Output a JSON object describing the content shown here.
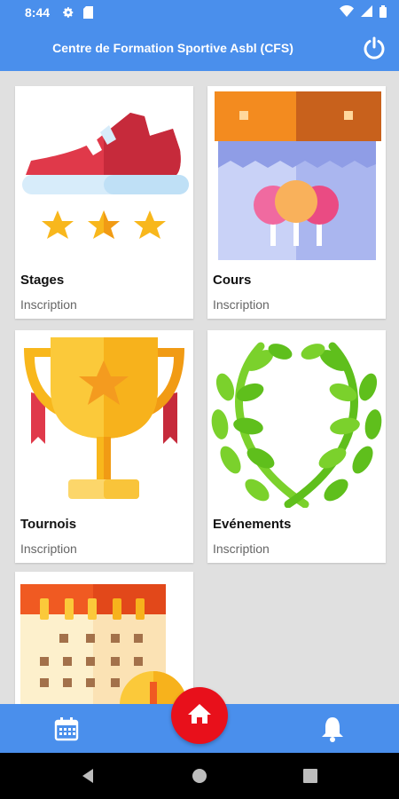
{
  "status_bar": {
    "time": "8:44",
    "icons": [
      "settings-icon",
      "sim-card-icon",
      "wifi-icon",
      "signal-icon",
      "battery-icon"
    ]
  },
  "app_bar": {
    "title": "Centre de Formation Sportive Asbl (CFS)",
    "power_icon": "power-icon"
  },
  "cards": [
    {
      "name": "Stages",
      "subtitle": "Inscription",
      "icon": "sneaker-icon"
    },
    {
      "name": "Cours",
      "subtitle": "Inscription",
      "icon": "party-balloons-icon"
    },
    {
      "name": "Tournois",
      "subtitle": "Inscription",
      "icon": "trophy-icon"
    },
    {
      "name": "Evénements",
      "subtitle": "Inscription",
      "icon": "laurel-wreath-icon"
    },
    {
      "name": "",
      "subtitle": "",
      "icon": "calendar-icon"
    }
  ],
  "bottom_nav": {
    "items": [
      "calendar-icon",
      "home-icon",
      "bell-icon"
    ],
    "active": "home"
  },
  "system_nav": [
    "back-icon",
    "home-circle-icon",
    "recents-icon"
  ],
  "colors": {
    "primary": "#4a8fec",
    "fab": "#e8101b",
    "background": "#e0e0e0"
  }
}
